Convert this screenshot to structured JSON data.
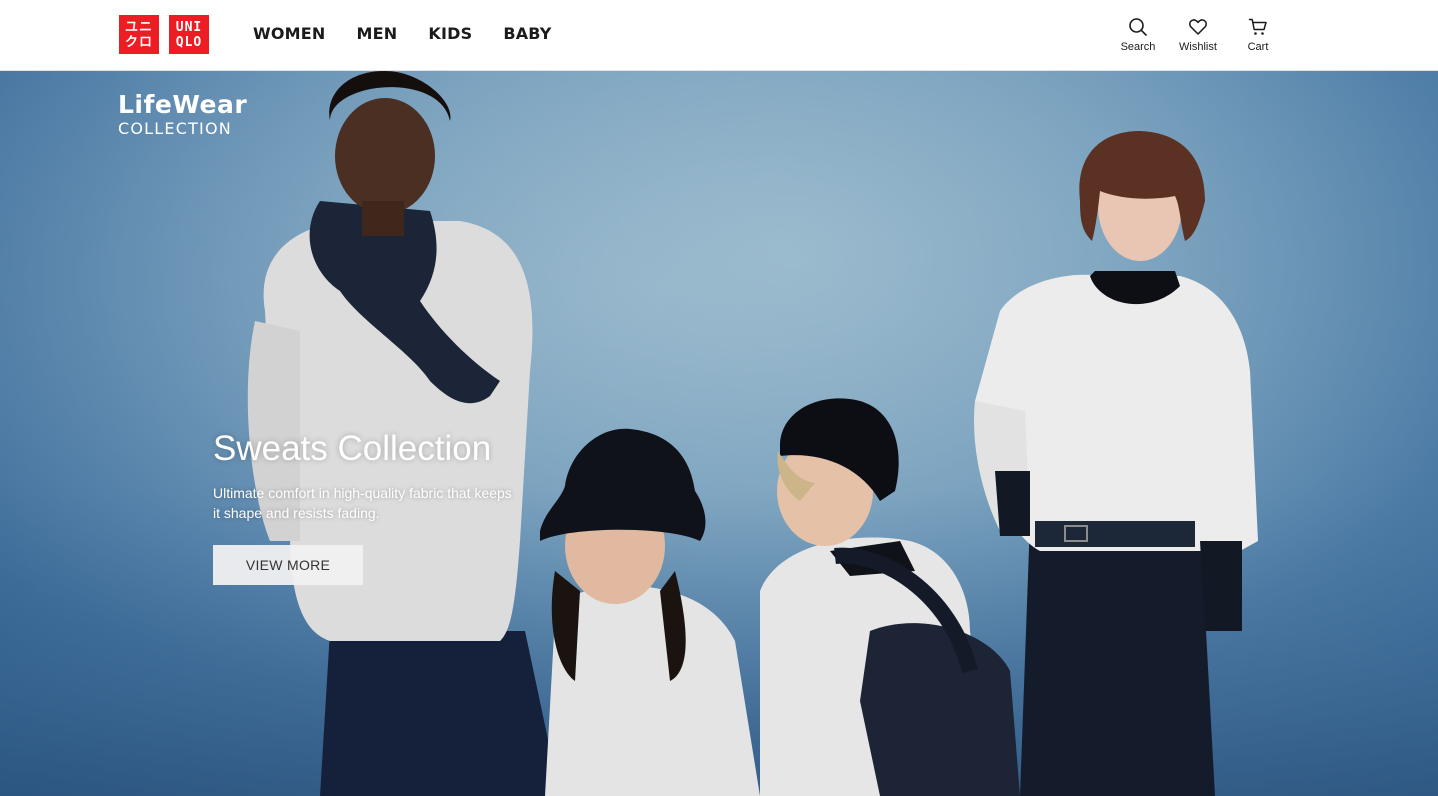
{
  "brand": {
    "logo_katakana_line1": "ユニ",
    "logo_katakana_line2": "クロ",
    "logo_latin_line1": "UNI",
    "logo_latin_line2": "QLO",
    "brand_color": "#ed1d24"
  },
  "nav": {
    "items": [
      {
        "label": "WOMEN"
      },
      {
        "label": "MEN"
      },
      {
        "label": "KIDS"
      },
      {
        "label": "BABY"
      }
    ]
  },
  "utilities": {
    "search": {
      "label": "Search",
      "icon": "search-icon"
    },
    "wishlist": {
      "label": "Wishlist",
      "icon": "heart-icon"
    },
    "cart": {
      "label": "Cart",
      "icon": "cart-icon"
    }
  },
  "hero": {
    "collection_title": "LifeWear",
    "collection_subtitle": "COLLECTION",
    "headline": "Sweats Collection",
    "description": "Ultimate comfort in high-quality fabric that keeps it shape and resists fading.",
    "cta_label": "VIEW MORE",
    "background_color": "#6d98b8"
  }
}
